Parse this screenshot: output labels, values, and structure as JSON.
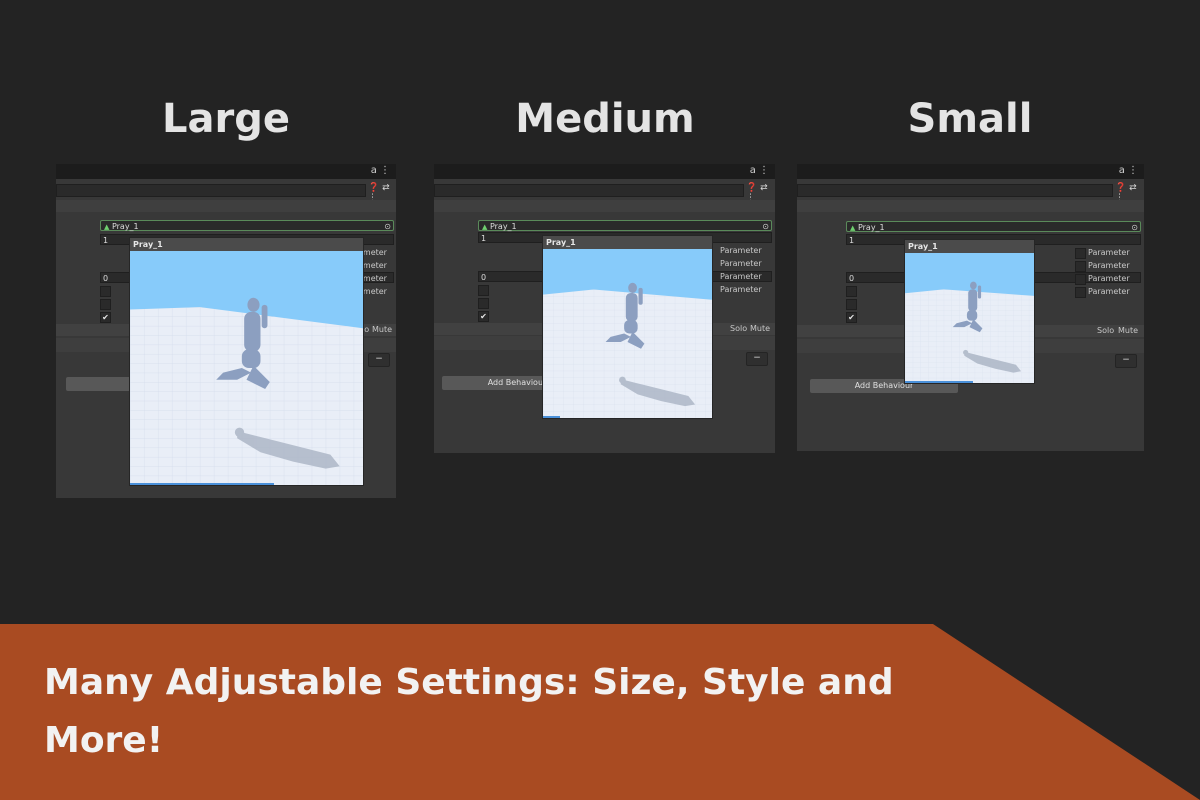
{
  "headings": {
    "large": "Large",
    "medium": "Medium",
    "small": "Small"
  },
  "inspector": {
    "tab_icons": "a ⋮",
    "header_icons": "❓ ⇄ ⋮",
    "clip_field": "Pray_1",
    "number_field_1": "1",
    "number_field_2": "0",
    "parameter_label_cut": "ameter",
    "parameter_label": "Parameter",
    "solo_label": "Solo",
    "mute_label": "Mute",
    "minus_label": "−",
    "add_behaviour_cut": "Add",
    "add_behaviour_label": "Add Behaviour"
  },
  "preview": {
    "title": "Pray_1",
    "sky_color": "#87cbfa",
    "floor_color": "#e9eef7"
  },
  "banner": {
    "text": "Many Adjustable Settings: Size, Style and More!",
    "color": "#a94b22"
  }
}
